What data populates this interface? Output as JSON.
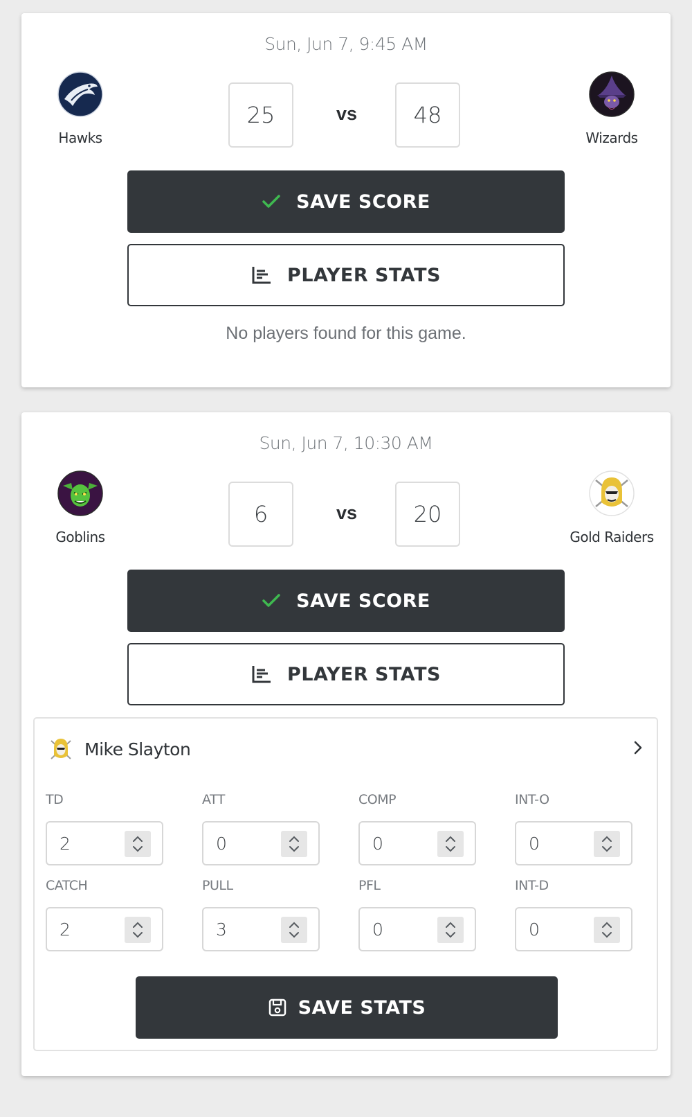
{
  "games": [
    {
      "time": "Sun, Jun 7, 9:45 AM",
      "home": {
        "name": "Hawks",
        "score": "25",
        "logo": "hawk-logo"
      },
      "vs": "vs",
      "away": {
        "name": "Wizards",
        "score": "48",
        "logo": "wizard-logo"
      },
      "save_score_label": "SAVE SCORE",
      "player_stats_label": "PLAYER STATS",
      "no_players_message": "No players found for this game."
    },
    {
      "time": "Sun, Jun 7, 10:30 AM",
      "home": {
        "name": "Goblins",
        "score": "6",
        "logo": "goblin-logo"
      },
      "vs": "vs",
      "away": {
        "name": "Gold Raiders",
        "score": "20",
        "logo": "raider-logo"
      },
      "save_score_label": "SAVE SCORE",
      "player_stats_label": "PLAYER STATS",
      "player": {
        "name": "Mike Slayton",
        "stats": [
          {
            "label": "TD",
            "value": "2"
          },
          {
            "label": "ATT",
            "value": "0"
          },
          {
            "label": "COMP",
            "value": "0"
          },
          {
            "label": "INT-O",
            "value": "0"
          },
          {
            "label": "CATCH",
            "value": "2"
          },
          {
            "label": "PULL",
            "value": "3"
          },
          {
            "label": "PFL",
            "value": "0"
          },
          {
            "label": "INT-D",
            "value": "0"
          }
        ],
        "save_stats_label": "SAVE STATS"
      }
    }
  ],
  "colors": {
    "button_dark": "#33373b",
    "check_green": "#3fb950",
    "card_bg": "#ffffff",
    "page_bg": "#ececec"
  }
}
